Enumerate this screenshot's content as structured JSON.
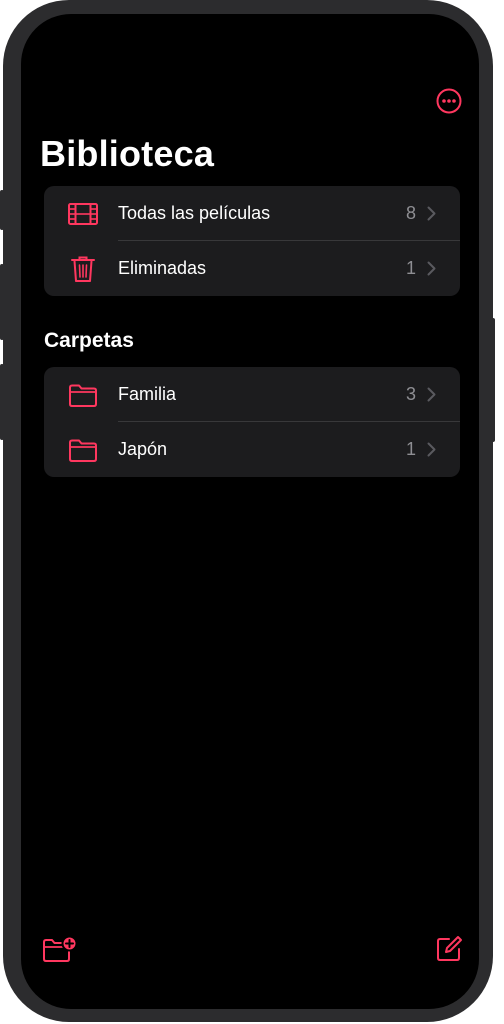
{
  "header": {
    "title": "Biblioteca"
  },
  "library": {
    "items": [
      {
        "label": "Todas las películas",
        "count": "8",
        "icon": "film-icon"
      },
      {
        "label": "Eliminadas",
        "count": "1",
        "icon": "trash-icon"
      }
    ]
  },
  "folders": {
    "header": "Carpetas",
    "items": [
      {
        "label": "Familia",
        "count": "3",
        "icon": "folder-icon"
      },
      {
        "label": "Japón",
        "count": "1",
        "icon": "folder-icon"
      }
    ]
  },
  "toolbar": {
    "left_icon": "new-folder-icon",
    "right_icon": "compose-icon",
    "top_icon": "more-icon"
  },
  "colors": {
    "accent": "#ff375f",
    "background": "#000000",
    "group_background": "#1c1c1e",
    "secondary_text": "#8e8e93"
  }
}
